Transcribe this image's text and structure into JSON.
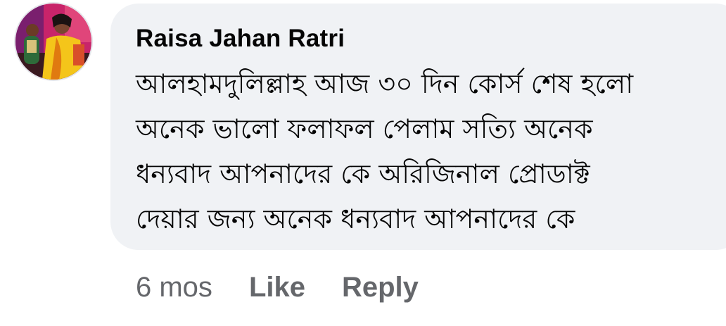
{
  "comment": {
    "author": "Raisa Jahan Ratri",
    "text": "আলহামদুলিল্লাহ আজ ৩০ দিন কোর্স শেষ হলো\nঅনেক ভালো ফলাফল পেলাম সত্যি অনেক\nধন্যবাদ আপনাদের কে অরিজিনাল প্রোডাক্ট\nদেয়ার জন্য অনেক ধন্যবাদ আপনাদের কে",
    "avatar_icon": "profile-photo",
    "bubble_color": "#f0f2f5"
  },
  "actions": {
    "time": "6 mos",
    "like_label": "Like",
    "reply_label": "Reply",
    "action_color": "#65676b"
  }
}
